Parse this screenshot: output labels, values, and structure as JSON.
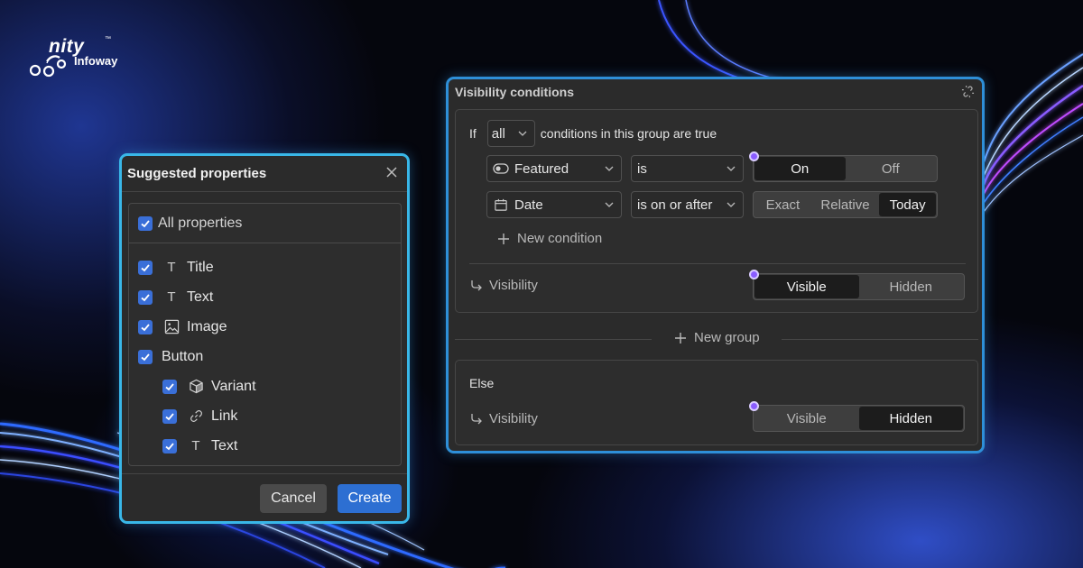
{
  "brand": {
    "name": "nity",
    "tm": "™",
    "sub": "Infoway",
    "logo_icon": "unity-logo-icon"
  },
  "colors": {
    "accent": "#2d6fd2",
    "panel_border": "#39b7e8",
    "indicator": "#8a5cff"
  },
  "suggested": {
    "title": "Suggested properties",
    "all_label": "All properties",
    "items": [
      {
        "label": "Title",
        "icon": "T",
        "level": 0
      },
      {
        "label": "Text",
        "icon": "T",
        "level": 0
      },
      {
        "label": "Image",
        "icon": "image-icon",
        "level": 0
      },
      {
        "label": "Button",
        "icon": "",
        "level": 0
      },
      {
        "label": "Variant",
        "icon": "cube-icon",
        "level": 1
      },
      {
        "label": "Link",
        "icon": "link-icon",
        "level": 1
      },
      {
        "label": "Text",
        "icon": "T",
        "level": 1
      }
    ],
    "cancel_label": "Cancel",
    "create_label": "Create"
  },
  "visibility": {
    "title": "Visibility conditions",
    "if_label": "If",
    "quantifier": "all",
    "condition_text": "conditions in this group are true",
    "conditions": [
      {
        "property": "Featured",
        "operator": "is",
        "options": [
          "On",
          "Off"
        ],
        "selected": "On"
      },
      {
        "property": "Date",
        "operator": "is on or after",
        "options": [
          "Exact",
          "Relative",
          "Today"
        ],
        "selected": "Today"
      }
    ],
    "new_condition_label": "New condition",
    "group_visibility": {
      "label": "Visibility",
      "options": [
        "Visible",
        "Hidden"
      ],
      "selected": "Visible"
    },
    "new_group_label": "New group",
    "else_label": "Else",
    "else_visibility": {
      "label": "Visibility",
      "options": [
        "Visible",
        "Hidden"
      ],
      "selected": "Hidden"
    }
  }
}
